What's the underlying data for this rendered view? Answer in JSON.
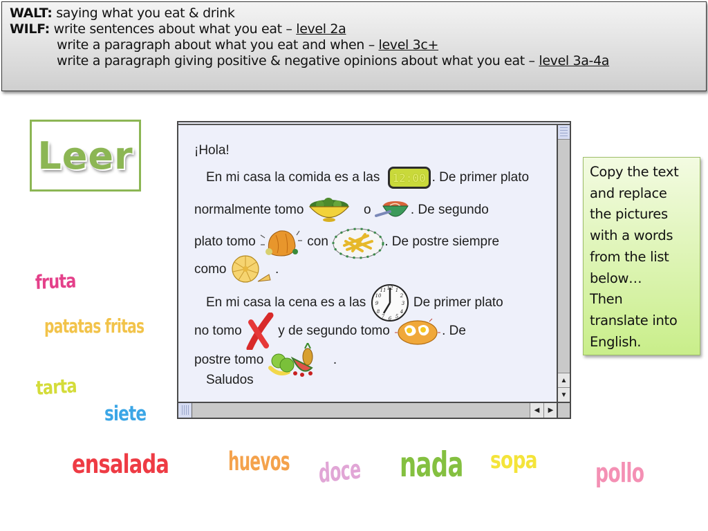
{
  "objectives": {
    "walt_label": "WALT:",
    "walt_text": " saying what you eat & drink",
    "wilf_label": "WILF:",
    "wilf_items": [
      {
        "text": " write sentences about what you eat – ",
        "level": "level 2a"
      },
      {
        "text": "write a paragraph about what you eat and when – ",
        "level": "level 3c+"
      },
      {
        "text": "write a paragraph giving positive & negative opinions about what you eat – ",
        "level": "level 3a-4a"
      }
    ]
  },
  "activity_label": "Leer",
  "reader": {
    "lines": {
      "greeting": "¡Hola!",
      "l1a": "En mi casa la comida es a las",
      "l1_clock": "12:00",
      "l1b": ". De primer plato",
      "l2a": "normalmente tomo",
      "l2b": "o",
      "l2c": ". De segundo",
      "l3a": "plato tomo",
      "l3b": "con",
      "l3c": ". De postre siempre",
      "l4a": "como",
      "l4b": ".",
      "l5a": "En mi casa la cena es a las",
      "l5b": "De primer plato",
      "l6a": "no tomo",
      "l6b": "y de segundo tomo",
      "l6c": ". De",
      "l7a": "postre tomo",
      "l7b": ".",
      "signoff": "Saludos"
    },
    "pictures": {
      "salad": "salad-bowl",
      "soup": "soup-bowl",
      "chicken": "roast-chicken",
      "fries": "plate-of-fries",
      "tart": "fruit-tart",
      "clock": "clock-seven",
      "nothing": "red-cross",
      "eggs": "fried-eggs",
      "fruit": "fruit-basket"
    },
    "scroll": {
      "up": "▲",
      "down": "▼",
      "left": "◀",
      "right": "▶"
    }
  },
  "instructions": [
    "Copy the text",
    "and replace",
    "the pictures",
    "with a words",
    "from the list",
    "below…",
    "Then",
    "translate into",
    "English."
  ],
  "word_bank": [
    {
      "word": "fruta",
      "color": "#e4408a"
    },
    {
      "word": "patatas fritas",
      "color": "#f2c34a"
    },
    {
      "word": "tarta",
      "color": "#d4dc3a"
    },
    {
      "word": "siete",
      "color": "#3ba6e6"
    },
    {
      "word": "ensalada",
      "color": "#ee3b44"
    },
    {
      "word": "huevos",
      "color": "#f4a24c"
    },
    {
      "word": "doce",
      "color": "#e1a6d6"
    },
    {
      "word": "nada",
      "color": "#84c040"
    },
    {
      "word": "sopa",
      "color": "#f4e43a"
    },
    {
      "word": "pollo",
      "color": "#f490b4"
    }
  ]
}
